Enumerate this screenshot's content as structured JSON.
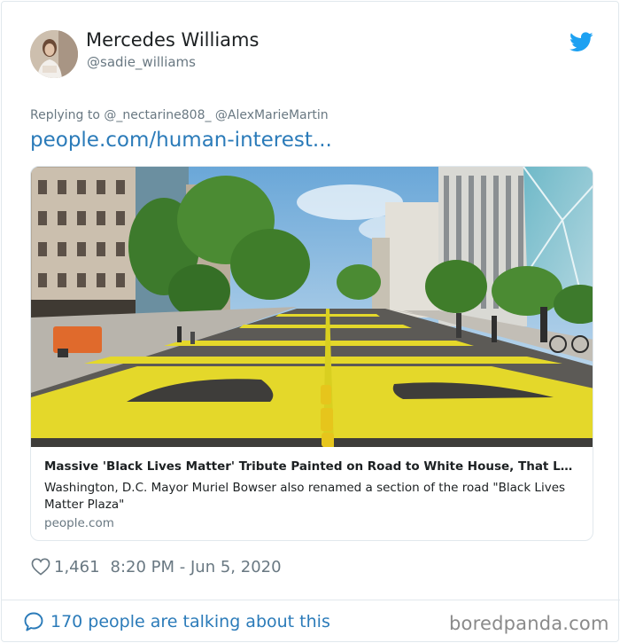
{
  "author": {
    "name": "Mercedes Williams",
    "handle": "@sadie_williams"
  },
  "icons": {
    "brand": "twitter-bird-icon",
    "like": "heart-icon",
    "reply": "speech-bubble-icon"
  },
  "colors": {
    "link": "#2b7bb9",
    "twitter_blue": "#1da1f2",
    "muted": "#697882",
    "street_paint": "#e4d82a"
  },
  "tweet": {
    "replying_to": "Replying to @_nectarine808_ @AlexMarieMartin",
    "link": "people.com/human-interest..."
  },
  "card": {
    "title": "Massive 'Black Lives Matter' Tribute Painted on Road to White House, That Leads Directly to Park Where Protesters Were Tear-Gassed",
    "description": "Washington, D.C. Mayor Muriel Bowser also renamed a section of the road \"Black Lives Matter Plaza\"",
    "domain": "people.com"
  },
  "stats": {
    "likes": "1,461",
    "timestamp": "8:20 PM - Jun 5, 2020"
  },
  "footer": {
    "talking": "170 people are talking about this"
  },
  "watermark": "boredpanda.com"
}
